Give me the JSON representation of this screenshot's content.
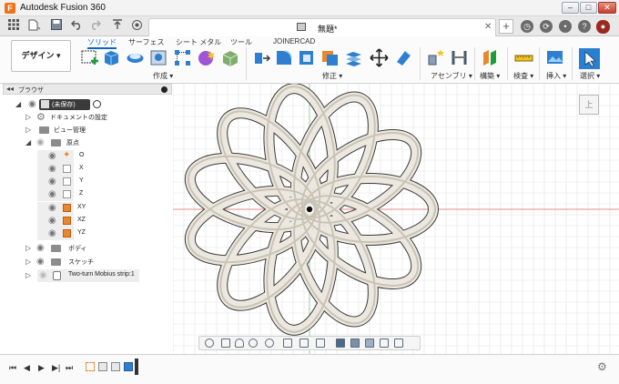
{
  "app": {
    "logo": "F",
    "title": "Autodesk Fusion 360"
  },
  "window_controls": {
    "minimize": "–",
    "maximize": "□",
    "close": "✕"
  },
  "doc_tab": {
    "label": "無題*",
    "close": "✕",
    "new_tab": "+"
  },
  "workspace": {
    "label": "デザイン ▾"
  },
  "ribbon_tabs": [
    {
      "label": "ソリッド"
    },
    {
      "label": "サーフェス"
    },
    {
      "label": "シート メタル"
    },
    {
      "label": "ツール"
    },
    {
      "label": "JOINERCAD"
    }
  ],
  "ribbon_groups": [
    {
      "label": "作成 ▾"
    },
    {
      "label": "修正 ▾"
    },
    {
      "label": "アセンブリ ▾"
    },
    {
      "label": "構築 ▾"
    },
    {
      "label": "検査 ▾"
    },
    {
      "label": "挿入 ▾"
    },
    {
      "label": "選択 ▾"
    }
  ],
  "browser": {
    "title": "ブラウザ",
    "collapse": "◂◂",
    "items": [
      {
        "label": "(未保存)",
        "level": 0
      },
      {
        "label": "ドキュメントの設定",
        "level": 1
      },
      {
        "label": "ビュー管理",
        "level": 1
      },
      {
        "label": "原点",
        "level": 1
      },
      {
        "label": "O",
        "level": 2
      },
      {
        "label": "X",
        "level": 2
      },
      {
        "label": "Y",
        "level": 2
      },
      {
        "label": "Z",
        "level": 2
      },
      {
        "label": "XY",
        "level": 2
      },
      {
        "label": "XZ",
        "level": 2
      },
      {
        "label": "YZ",
        "level": 2
      },
      {
        "label": "ボディ",
        "level": 1
      },
      {
        "label": "スケッチ",
        "level": 1
      },
      {
        "label": "Two-turn Mobius strip:1",
        "level": 1
      }
    ]
  },
  "viewcube": {
    "face": "上"
  },
  "colors": {
    "accent": "#0a65c2",
    "model": "#ece8df",
    "model_edge": "#3a3a3a",
    "grid": "#e3e3e3",
    "axis_red": "#e88a8a",
    "axis_green": "#9ad09a"
  },
  "timeline": {
    "controls": [
      "⏮",
      "◀",
      "▶",
      "▶|",
      "⏭"
    ]
  },
  "icons": [
    "grid-icon",
    "file-icon",
    "save-icon",
    "undo-icon",
    "redo-icon",
    "user-icon",
    "gear-icon",
    "eye-icon",
    "folder-icon"
  ]
}
